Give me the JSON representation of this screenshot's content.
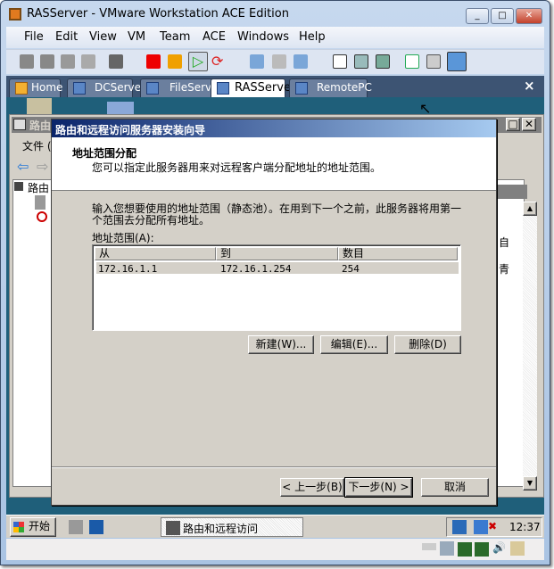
{
  "window": {
    "title": "RASServer - VMware Workstation ACE Edition"
  },
  "menu": [
    "File",
    "Edit",
    "View",
    "VM",
    "Team",
    "ACE",
    "Windows",
    "Help"
  ],
  "tabs": [
    {
      "label": "Home"
    },
    {
      "label": "DCServer"
    },
    {
      "label": "FileServer"
    },
    {
      "label": "RASServer",
      "active": true
    },
    {
      "label": "RemotePC"
    }
  ],
  "tab_close": "×",
  "mmc": {
    "title": "路由",
    "menu_file": "文件 (",
    "tree_root": "路由",
    "right_text_1": "自",
    "right_text_2": "青"
  },
  "wizard": {
    "title": "路由和远程访问服务器安装向导",
    "heading": "地址范围分配",
    "subheading": "您可以指定此服务器用来对远程客户端分配地址的地址范围。",
    "instruction": "输入您想要使用的地址范围（静态池）。在用到下一个之前，此服务器将用第一个范围去分配所有地址。",
    "list_label": "地址范围(A):",
    "columns": [
      "从",
      "到",
      "数目"
    ],
    "rows": [
      {
        "from": "172.16.1.1",
        "to": "172.16.1.254",
        "count": "254"
      }
    ],
    "new_btn": "新建(W)...",
    "edit_btn": "编辑(E)...",
    "delete_btn": "删除(D)",
    "back_btn": "< 上一步(B)",
    "next_btn": "下一步(N) >",
    "cancel_btn": "取消"
  },
  "taskbar": {
    "start": "开始",
    "task": "路由和远程访问",
    "clock": "12:37"
  },
  "colors": {
    "dialog_title_start": "#0a246a",
    "dialog_title_end": "#a6caf0",
    "guest_bg": "#1f5f7a"
  }
}
